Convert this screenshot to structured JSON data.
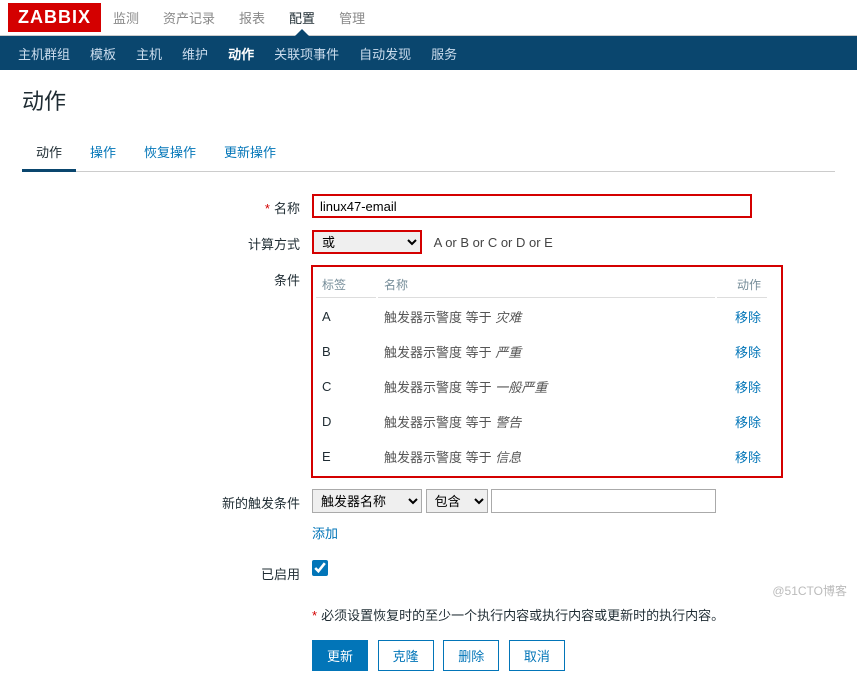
{
  "logo_text": "ZABBIX",
  "topnav": {
    "items": [
      "监测",
      "资产记录",
      "报表",
      "配置",
      "管理"
    ],
    "active_index": 3
  },
  "subnav": {
    "items": [
      "主机群组",
      "模板",
      "主机",
      "维护",
      "动作",
      "关联项事件",
      "自动发现",
      "服务"
    ],
    "active_index": 4
  },
  "page_title": "动作",
  "tabs": {
    "items": [
      "动作",
      "操作",
      "恢复操作",
      "更新操作"
    ],
    "active_index": 0
  },
  "form": {
    "name_label": "名称",
    "name_value": "linux47-email",
    "calc_label": "计算方式",
    "calc_value": "或",
    "calc_hint": "A or B or C or D or E",
    "cond_label": "条件",
    "cond_headers": {
      "label": "标签",
      "name": "名称",
      "action": "动作"
    },
    "conditions": [
      {
        "label": "A",
        "desc_prefix": "触发器示警度 等于 ",
        "desc_value": "灾难"
      },
      {
        "label": "B",
        "desc_prefix": "触发器示警度 等于 ",
        "desc_value": "严重"
      },
      {
        "label": "C",
        "desc_prefix": "触发器示警度 等于 ",
        "desc_value": "一般严重"
      },
      {
        "label": "D",
        "desc_prefix": "触发器示警度 等于 ",
        "desc_value": "警告"
      },
      {
        "label": "E",
        "desc_prefix": "触发器示警度 等于 ",
        "desc_value": "信息"
      }
    ],
    "remove_label": "移除",
    "newcond_label": "新的触发条件",
    "newcond_type": "触发器名称",
    "newcond_op": "包含",
    "newcond_value": "",
    "add_label": "添加",
    "enabled_label": "已启用",
    "enabled_value": true,
    "footnote": "必须设置恢复时的至少一个执行内容或执行内容或更新时的执行内容。",
    "buttons": {
      "update": "更新",
      "clone": "克隆",
      "delete": "删除",
      "cancel": "取消"
    }
  },
  "watermark": "@51CTO博客"
}
